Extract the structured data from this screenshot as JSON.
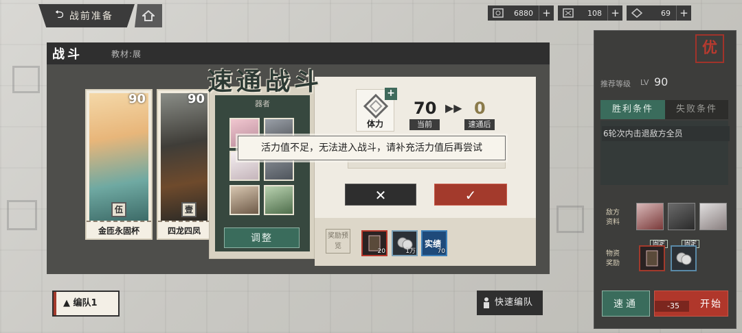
{
  "top_bar": {
    "back_label": "战前准备",
    "resources": [
      {
        "icon": "coin-icon",
        "value": "6880"
      },
      {
        "icon": "crystal-icon",
        "value": "108"
      },
      {
        "icon": "stamina-diamond-icon",
        "value": "69"
      }
    ],
    "plus_label": "+"
  },
  "battle": {
    "title": "战斗",
    "material": "教材:展"
  },
  "cards": [
    {
      "level": "90",
      "tier": "伍",
      "name": "金匝永固杯"
    },
    {
      "level": "90",
      "tier": "壹",
      "name": "四龙四凤"
    }
  ],
  "quick_battle": {
    "title": "速通战斗",
    "vessel_label": "器者",
    "adjust_label": "调整",
    "stamina_label": "体力",
    "stamina_plus": "+",
    "current_value": "70",
    "current_label": "当前",
    "after_value": "0",
    "after_label": "速通后",
    "cancel_symbol": "✕",
    "confirm_symbol": "✓",
    "reward_label_chars": [
      "奖",
      "励",
      "预",
      "览"
    ],
    "rewards": [
      {
        "icon": "book-icon",
        "count": "20",
        "color": "#b8372b"
      },
      {
        "icon": "coin-stack-icon",
        "count": "1万",
        "color": "#7aa0b8"
      },
      {
        "icon": "record-icon",
        "count": "70",
        "color": "#3d7fb8",
        "text": "实绩"
      }
    ]
  },
  "toast": {
    "message": "活力值不足，无法进入战斗，请补充活力值后再尝试"
  },
  "right_panel": {
    "badge": "优",
    "rec_level_label": "推荐等级",
    "lv_label": "LV",
    "rec_level_value": "90",
    "win_tab": "胜利条件",
    "lose_tab": "失败条件",
    "win_condition": "6轮次内击退敌方全员",
    "enemy_label": "敌方资料",
    "drop_label": "物资奖励",
    "fixed_tag": "固定",
    "auto_label": "速通",
    "start_label": "开始",
    "start_cost": "-35"
  },
  "bottom": {
    "formation_label": "▲ 编队1",
    "quick_formation_label": "快速编队"
  },
  "colors": {
    "accent_red": "#a33a2c",
    "accent_green": "#3a6c5c",
    "dark_panel": "#3d3d3b"
  }
}
